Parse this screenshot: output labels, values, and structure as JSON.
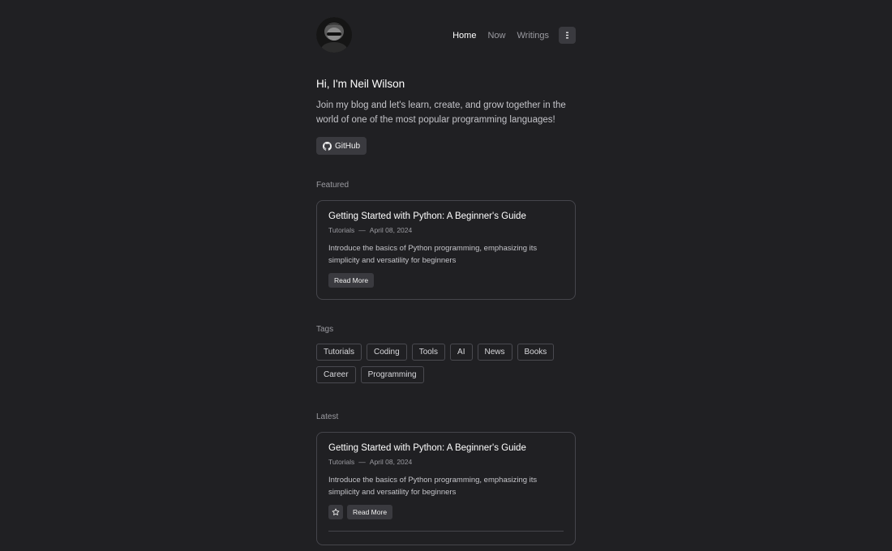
{
  "header": {
    "nav": [
      {
        "label": "Home",
        "active": true
      },
      {
        "label": "Now",
        "active": false
      },
      {
        "label": "Writings",
        "active": false
      }
    ],
    "menu_icon": "menu-icon"
  },
  "hero": {
    "title": "Hi, I'm Neil Wilson",
    "text": "Join my blog and let's learn, create, and grow together in the world of one of the most popular programming languages!",
    "github_label": "GitHub"
  },
  "featured": {
    "label": "Featured",
    "post": {
      "title": "Getting Started with Python: A Beginner's Guide",
      "category": "Tutorials",
      "dash": "—",
      "date": "April 08, 2024",
      "description": "Introduce the basics of Python programming, emphasizing its simplicity and versatility for beginners",
      "read_more": "Read More"
    }
  },
  "tags": {
    "label": "Tags",
    "items": [
      "Tutorials",
      "Coding",
      "Tools",
      "AI",
      "News",
      "Books",
      "Career",
      "Programming"
    ]
  },
  "latest": {
    "label": "Latest",
    "post": {
      "title": "Getting Started with Python: A Beginner's Guide",
      "category": "Tutorials",
      "dash": "—",
      "date": "April 08, 2024",
      "description": "Introduce the basics of Python programming, emphasizing its simplicity and versatility for beginners",
      "read_more": "Read More",
      "star_icon": "star-icon"
    }
  },
  "colors": {
    "background": "#202023",
    "card_border": "#45454b",
    "button_bg": "#3a3a3f"
  }
}
